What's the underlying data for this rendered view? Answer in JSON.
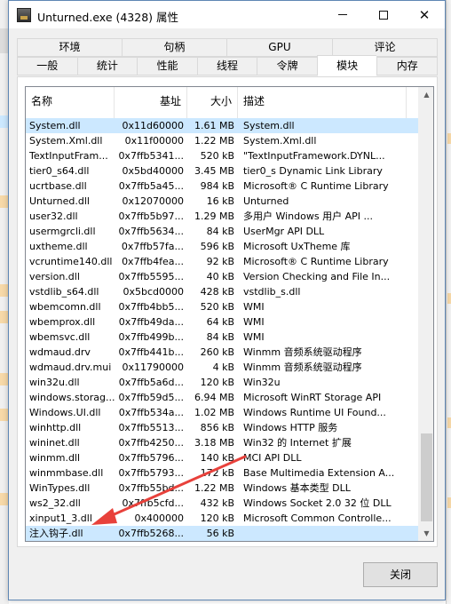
{
  "window": {
    "title": "Unturned.exe (4328) 属性"
  },
  "tabs": {
    "row1": [
      "环境",
      "句柄",
      "GPU",
      "评论"
    ],
    "row2": [
      "一般",
      "统计",
      "性能",
      "线程",
      "令牌",
      "模块",
      "内存"
    ],
    "active": "模块"
  },
  "modules": {
    "columns": [
      "名称",
      "基址",
      "大小",
      "描述"
    ],
    "rows": [
      {
        "name": "System.dll",
        "base": "0x11d60000",
        "size": "1.61 MB",
        "desc": "System.dll",
        "selected": true
      },
      {
        "name": "System.Xml.dll",
        "base": "0x11f00000",
        "size": "1.22 MB",
        "desc": "System.Xml.dll"
      },
      {
        "name": "TextInputFram...",
        "base": "0x7ffb5341...",
        "size": "520 kB",
        "desc": "\"TextInputFramework.DYNL..."
      },
      {
        "name": "tier0_s64.dll",
        "base": "0x5bd40000",
        "size": "3.45 MB",
        "desc": "tier0_s Dynamic Link Library"
      },
      {
        "name": "ucrtbase.dll",
        "base": "0x7ffb5a45...",
        "size": "984 kB",
        "desc": "Microsoft® C Runtime Library"
      },
      {
        "name": "Unturned.dll",
        "base": "0x12070000",
        "size": "16 kB",
        "desc": "Unturned"
      },
      {
        "name": "user32.dll",
        "base": "0x7ffb5b97...",
        "size": "1.29 MB",
        "desc": "多用户 Windows 用户 API ..."
      },
      {
        "name": "usermgrcli.dll",
        "base": "0x7ffb5634...",
        "size": "84 kB",
        "desc": "UserMgr API DLL"
      },
      {
        "name": "uxtheme.dll",
        "base": "0x7ffb57fa...",
        "size": "596 kB",
        "desc": "Microsoft UxTheme 库"
      },
      {
        "name": "vcruntime140.dll",
        "base": "0x7ffb4fea...",
        "size": "92 kB",
        "desc": "Microsoft® C Runtime Library"
      },
      {
        "name": "version.dll",
        "base": "0x7ffb5595...",
        "size": "40 kB",
        "desc": "Version Checking and File In..."
      },
      {
        "name": "vstdlib_s64.dll",
        "base": "0x5bcd0000",
        "size": "428 kB",
        "desc": "vstdlib_s.dll"
      },
      {
        "name": "wbemcomn.dll",
        "base": "0x7ffb4bb5...",
        "size": "520 kB",
        "desc": "WMI"
      },
      {
        "name": "wbemprox.dll",
        "base": "0x7ffb49da...",
        "size": "64 kB",
        "desc": "WMI"
      },
      {
        "name": "wbemsvc.dll",
        "base": "0x7ffb499b...",
        "size": "84 kB",
        "desc": "WMI"
      },
      {
        "name": "wdmaud.drv",
        "base": "0x7ffb441b...",
        "size": "260 kB",
        "desc": "Winmm 音频系统驱动程序"
      },
      {
        "name": "wdmaud.drv.mui",
        "base": "0x11790000",
        "size": "4 kB",
        "desc": "Winmm 音频系统驱动程序"
      },
      {
        "name": "win32u.dll",
        "base": "0x7ffb5a6d...",
        "size": "120 kB",
        "desc": "Win32u"
      },
      {
        "name": "windows.storag...",
        "base": "0x7ffb59d5...",
        "size": "6.94 MB",
        "desc": "Microsoft WinRT Storage API"
      },
      {
        "name": "Windows.UI.dll",
        "base": "0x7ffb534a...",
        "size": "1.02 MB",
        "desc": "Windows Runtime UI Found..."
      },
      {
        "name": "winhttp.dll",
        "base": "0x7ffb5513...",
        "size": "856 kB",
        "desc": "Windows HTTP 服务"
      },
      {
        "name": "wininet.dll",
        "base": "0x7ffb4250...",
        "size": "3.18 MB",
        "desc": "Win32 的 Internet 扩展"
      },
      {
        "name": "winmm.dll",
        "base": "0x7ffb5796...",
        "size": "140 kB",
        "desc": "MCI API DLL"
      },
      {
        "name": "winmmbase.dll",
        "base": "0x7ffb5793...",
        "size": "172 kB",
        "desc": "Base Multimedia Extension A..."
      },
      {
        "name": "WinTypes.dll",
        "base": "0x7ffb55bd...",
        "size": "1.22 MB",
        "desc": "Windows 基本类型 DLL"
      },
      {
        "name": "ws2_32.dll",
        "base": "0x7ffb5cfd...",
        "size": "432 kB",
        "desc": "Windows Socket 2.0 32 位 DLL"
      },
      {
        "name": "xinput1_3.dll",
        "base": "0x400000",
        "size": "120 kB",
        "desc": "Microsoft Common Controlle..."
      },
      {
        "name": "注入钩子.dll",
        "base": "0x7ffb5268...",
        "size": "56 kB",
        "desc": "",
        "selected": true
      }
    ]
  },
  "buttons": {
    "close": "关闭"
  },
  "annotation": {
    "color": "#e8413b"
  }
}
